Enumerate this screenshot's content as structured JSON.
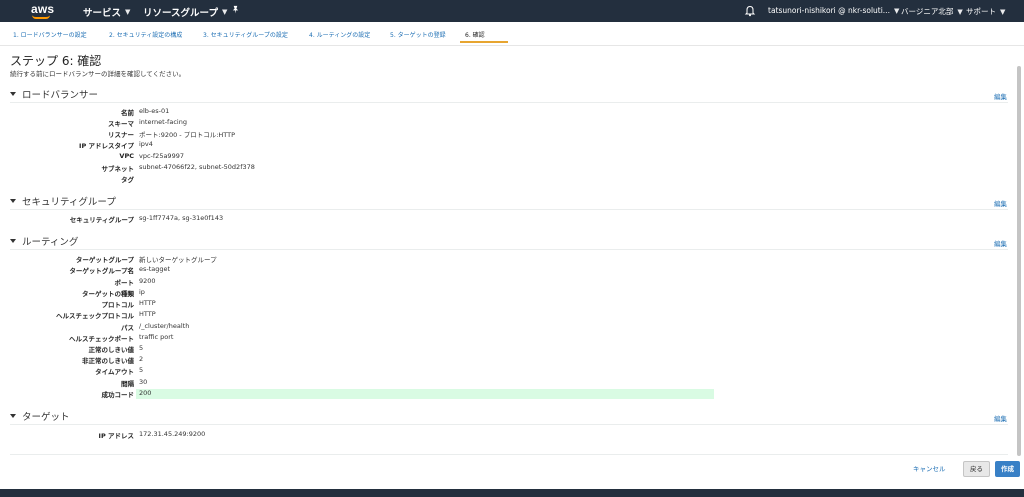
{
  "topnav": {
    "logo": "aws",
    "services": "サービス",
    "resource_groups": "リソースグループ",
    "user": "tatsunori-nishikori @ nkr-soluti...",
    "region": "バージニア北部",
    "support": "サポート"
  },
  "steps": [
    {
      "label": "1. ロードバランサーの設定"
    },
    {
      "label": "2. セキュリティ設定の構成"
    },
    {
      "label": "3. セキュリティグループの設定"
    },
    {
      "label": "4. ルーティングの設定"
    },
    {
      "label": "5. ターゲットの登録"
    },
    {
      "label": "6. 確認"
    }
  ],
  "page": {
    "title": "ステップ 6: 確認",
    "subtitle": "続行する前にロードバランサーの詳細を確認してください。"
  },
  "edit_label": "編集",
  "sections": {
    "lb": {
      "title": "ロードバランサー",
      "rows": [
        {
          "label": "名前",
          "value": "elb-es-01"
        },
        {
          "label": "スキーマ",
          "value": "internet-facing"
        },
        {
          "label": "リスナー",
          "value": "ポート:9200 - プロトコル:HTTP"
        },
        {
          "label": "IP アドレスタイプ",
          "value": "ipv4"
        },
        {
          "label": "VPC",
          "value": "vpc-f25a9997"
        },
        {
          "label": "サブネット",
          "value": "subnet-47066f22, subnet-50d2f378"
        },
        {
          "label": "タグ",
          "value": ""
        }
      ]
    },
    "sg": {
      "title": "セキュリティグループ",
      "rows": [
        {
          "label": "セキュリティグループ",
          "value": "sg-1ff7747a, sg-31e0f143"
        }
      ]
    },
    "routing": {
      "title": "ルーティング",
      "rows": [
        {
          "label": "ターゲットグループ",
          "value": "新しいターゲットグループ"
        },
        {
          "label": "ターゲットグループ名",
          "value": "es-tagget"
        },
        {
          "label": "ポート",
          "value": "9200"
        },
        {
          "label": "ターゲットの種類",
          "value": "ip"
        },
        {
          "label": "プロトコル",
          "value": "HTTP"
        },
        {
          "label": "ヘルスチェックプロトコル",
          "value": "HTTP"
        },
        {
          "label": "パス",
          "value": "/_cluster/health"
        },
        {
          "label": "ヘルスチェックポート",
          "value": "traffic port"
        },
        {
          "label": "正常のしきい値",
          "value": "5"
        },
        {
          "label": "非正常のしきい値",
          "value": "2"
        },
        {
          "label": "タイムアウト",
          "value": "5"
        },
        {
          "label": "間隔",
          "value": "30"
        },
        {
          "label": "成功コード",
          "value": "200"
        }
      ]
    },
    "target": {
      "title": "ターゲット",
      "rows": [
        {
          "label": "IP アドレス",
          "value": "172.31.45.249:9200"
        }
      ]
    }
  },
  "footer": {
    "cancel": "キャンセル",
    "back": "戻る",
    "create": "作成"
  },
  "colors": {
    "nav_bg": "#232f3e",
    "accent": "#ff9900",
    "link": "#1b6db3",
    "primary_button": "#3880c6",
    "highlight": "#d9fbe3"
  }
}
